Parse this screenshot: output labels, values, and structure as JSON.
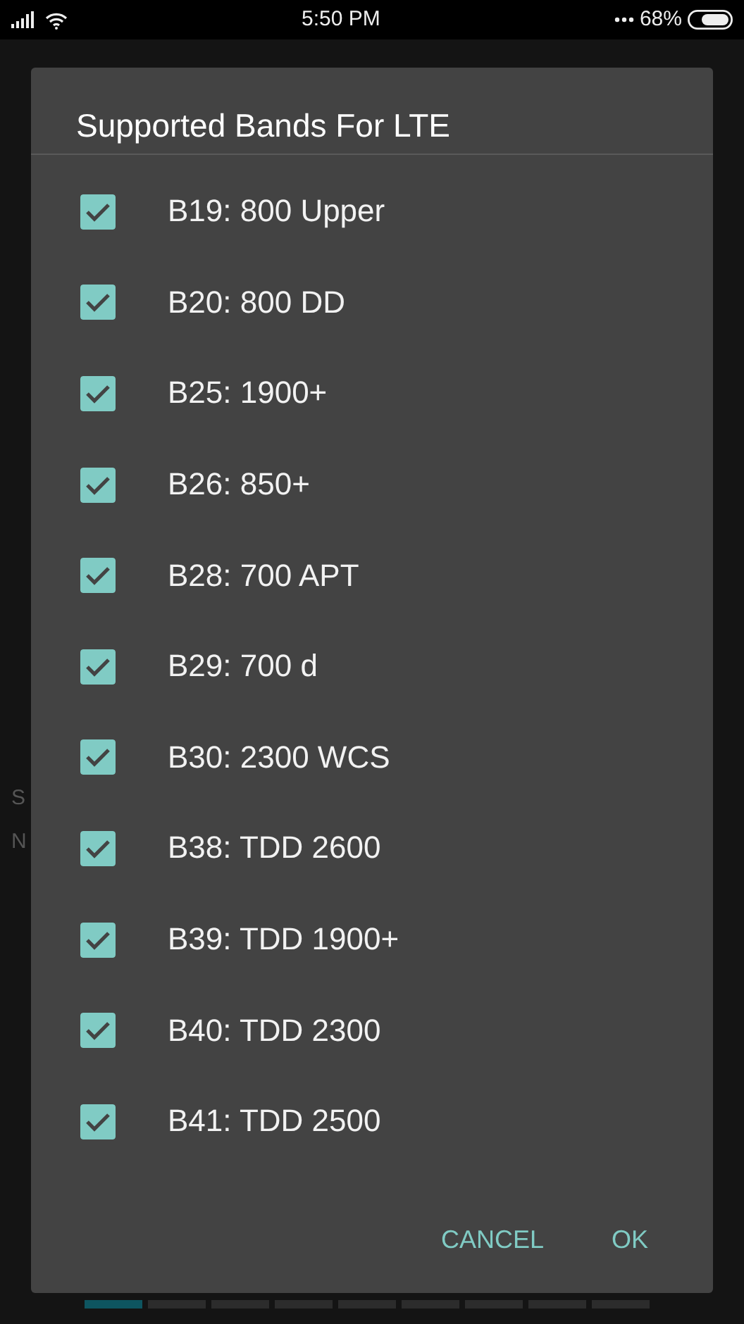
{
  "status_bar": {
    "time": "5:50 PM",
    "battery": "68%"
  },
  "background": {
    "letters": [
      "S",
      "N"
    ]
  },
  "dialog": {
    "title": "Supported Bands For LTE",
    "items": [
      {
        "label": "B19: 800 Upper",
        "checked": true
      },
      {
        "label": "B20: 800 DD",
        "checked": true
      },
      {
        "label": "B25: 1900+",
        "checked": true
      },
      {
        "label": "B26: 850+",
        "checked": true
      },
      {
        "label": "B28: 700 APT",
        "checked": true
      },
      {
        "label": "B29: 700 d",
        "checked": true
      },
      {
        "label": "B30: 2300 WCS",
        "checked": true
      },
      {
        "label": "B38: TDD 2600",
        "checked": true
      },
      {
        "label": "B39: TDD 1900+",
        "checked": true
      },
      {
        "label": "B40: TDD 2300",
        "checked": true
      },
      {
        "label": "B41: TDD 2500",
        "checked": true
      }
    ],
    "buttons": [
      "CANCEL",
      "OK"
    ]
  },
  "page_indicator": [
    {
      "selected": true
    },
    {
      "selected": false
    },
    {
      "selected": false
    },
    {
      "selected": false
    },
    {
      "selected": false
    },
    {
      "selected": false
    },
    {
      "selected": false
    },
    {
      "selected": false
    },
    {
      "selected": false
    }
  ]
}
